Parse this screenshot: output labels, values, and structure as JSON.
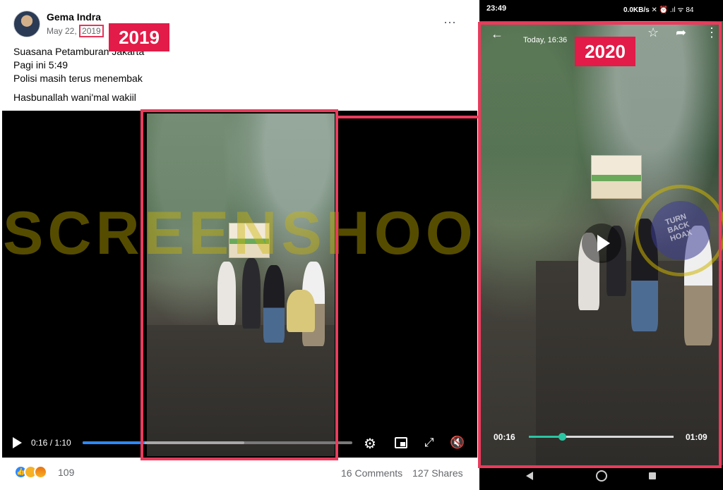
{
  "fb_post": {
    "author": "Gema Indra",
    "date_prefix": "May 22, ",
    "year": "2019",
    "badge_year": "2019",
    "more_icon": "⋯",
    "caption_lines": [
      "Suasana Petamburan Jakarta",
      "Pagi ini 5:49",
      "Polisi masih terus menembak"
    ],
    "caption_extra": "Hasbunallah wani'mal wakiil",
    "video": {
      "current_time": "0:16",
      "duration": "1:10",
      "time_label": "0:16 / 1:10",
      "progress": 0.23,
      "buffered": 0.6
    },
    "watermark": "SCREENSHOOT BY",
    "reactions": {
      "types": [
        "like",
        "sad",
        "angry"
      ],
      "count": "109",
      "comments": "16 Comments",
      "shares": "127 Shares"
    }
  },
  "phone": {
    "status_time": "23:49",
    "status_right": "0.0KB/s",
    "battery": "84",
    "today_label": "Today, 16:36",
    "badge_year": "2020",
    "seal_text": "TURN BACK HOAX",
    "current_time": "00:16",
    "total_time": "01:09",
    "progress": 0.23
  },
  "colors": {
    "highlight": "#ea3b5c",
    "badge": "#e21b48",
    "fb_progress": "#2d88ff",
    "phone_progress": "#2bc4a2"
  }
}
